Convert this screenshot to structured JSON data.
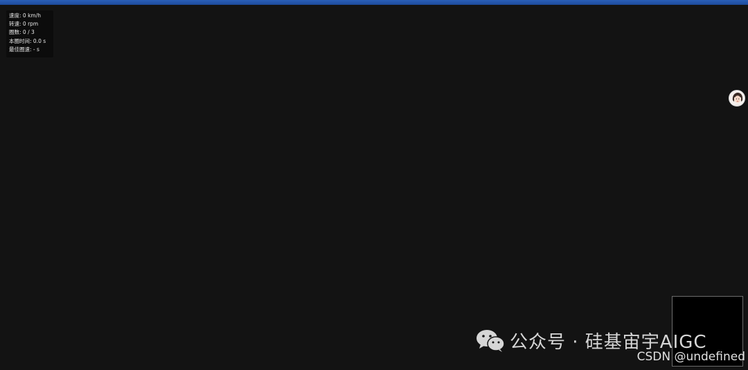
{
  "hud": {
    "speed": "速度: 0 km/h",
    "rpm": "转速: 0 rpm",
    "laps": "圈数: 0 / 3",
    "lap_time": "本圈时间: 0.0 s",
    "best_lap": "最佳圈速: - s"
  },
  "watermark": {
    "text": "公众号 · 硅基宙宇AIGC",
    "icon": "wechat-icon"
  },
  "footer": {
    "csdn": "CSDN @undefined"
  },
  "colors": {
    "background": "#131313",
    "topbar": "#1d4a9b",
    "hud_bg": "#0c0c0c"
  }
}
